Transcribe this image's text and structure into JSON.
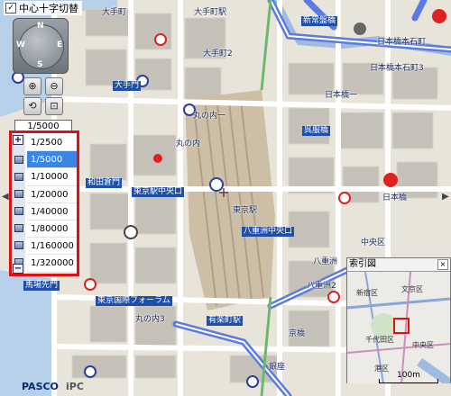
{
  "toolbar": {
    "crosshair_checkbox_label": "中心十字切替",
    "crosshair_checked": true
  },
  "navigation": {
    "north": "N",
    "west": "W",
    "east": "E",
    "south": "S"
  },
  "zoom_buttons": {
    "zoom_in_icon": "magnifier-plus-icon",
    "zoom_out_icon": "magnifier-minus-icon",
    "reset_icon": "rotate-icon",
    "fit_icon": "magnifier-square-icon"
  },
  "scale": {
    "current": "1/5000",
    "options": [
      "1/2500",
      "1/5000",
      "1/10000",
      "1/20000",
      "1/40000",
      "1/80000",
      "1/160000",
      "1/320000"
    ],
    "selected_index": 1,
    "plus": "+",
    "minus": "−",
    "highlight_color": "#e01010"
  },
  "map_labels": {
    "l1": "大手町",
    "l2": "大手町駅",
    "l3": "新常盤橋",
    "l4": "日本橋本石町",
    "l5": "大手町2",
    "l6": "日本橋本石町3",
    "l7": "大手門",
    "l8": "丸の内一",
    "l9": "日本橋一",
    "l10": "丸の内",
    "l11": "和田倉門",
    "l12": "東京駅中央口",
    "l13": "日本橋",
    "l14": "八重洲中央口",
    "l15": "八重洲",
    "l16": "東京国際フォーラム",
    "l17": "丸の内3",
    "l18": "有楽町駅",
    "l19": "京橋",
    "l20": "銀座",
    "l21": "馬場先門",
    "l22": "中央区",
    "l23": "東京駅",
    "l24": "呉服橋",
    "l25": "八重洲2"
  },
  "index_map": {
    "title": "索引図",
    "close": "×",
    "inner_labels": [
      "新宿区",
      "文京区",
      "千代田区",
      "中央区",
      "港区"
    ]
  },
  "footer": {
    "brand": "PASCO",
    "brand2": "iPC",
    "scalebar_label": "100m"
  },
  "colors": {
    "water": "#b7d0ea",
    "road_major": "#ffffff",
    "road_highway": "#5b7be0",
    "building": "#c9c6bf",
    "station": "#c8b9a0"
  }
}
